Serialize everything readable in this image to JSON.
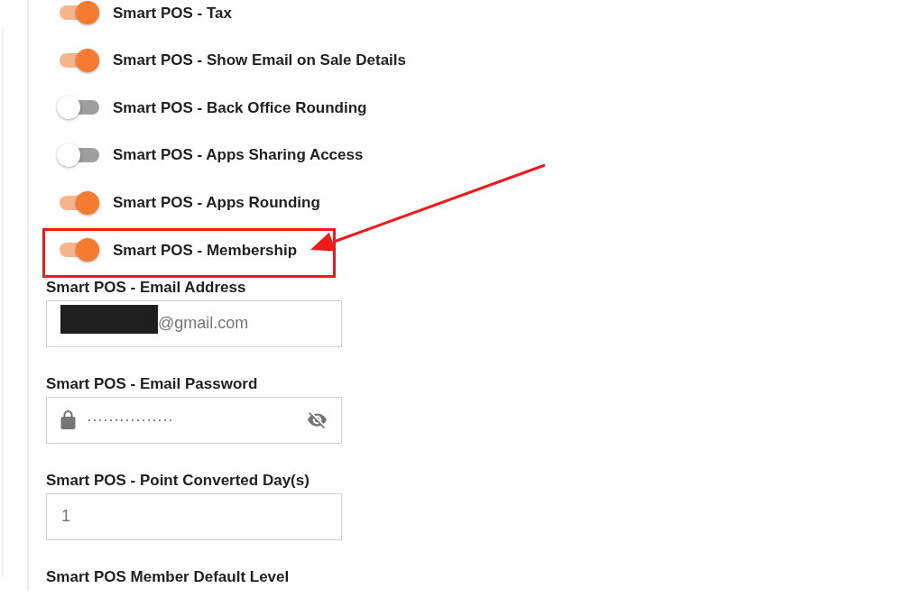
{
  "settings": [
    {
      "label": "Smart POS - Tax",
      "on": true,
      "highlighted": false
    },
    {
      "label": "Smart POS - Show Email on Sale Details",
      "on": true,
      "highlighted": false
    },
    {
      "label": "Smart POS - Back Office Rounding",
      "on": false,
      "highlighted": false
    },
    {
      "label": "Smart POS - Apps Sharing Access",
      "on": false,
      "highlighted": false
    },
    {
      "label": "Smart POS - Apps Rounding",
      "on": true,
      "highlighted": false
    },
    {
      "label": "Smart POS - Membership",
      "on": true,
      "highlighted": true
    }
  ],
  "fields": [
    {
      "kind": "email",
      "label": "Smart POS - Email Address",
      "value": "@gmail.com",
      "redacted": true
    },
    {
      "kind": "password",
      "label": "Smart POS - Email Password",
      "value": "················"
    },
    {
      "kind": "number",
      "label": "Smart POS - Point Converted Day(s)",
      "value": "1"
    },
    {
      "kind": "cut_off",
      "label": "Smart POS Member Default Level"
    }
  ]
}
